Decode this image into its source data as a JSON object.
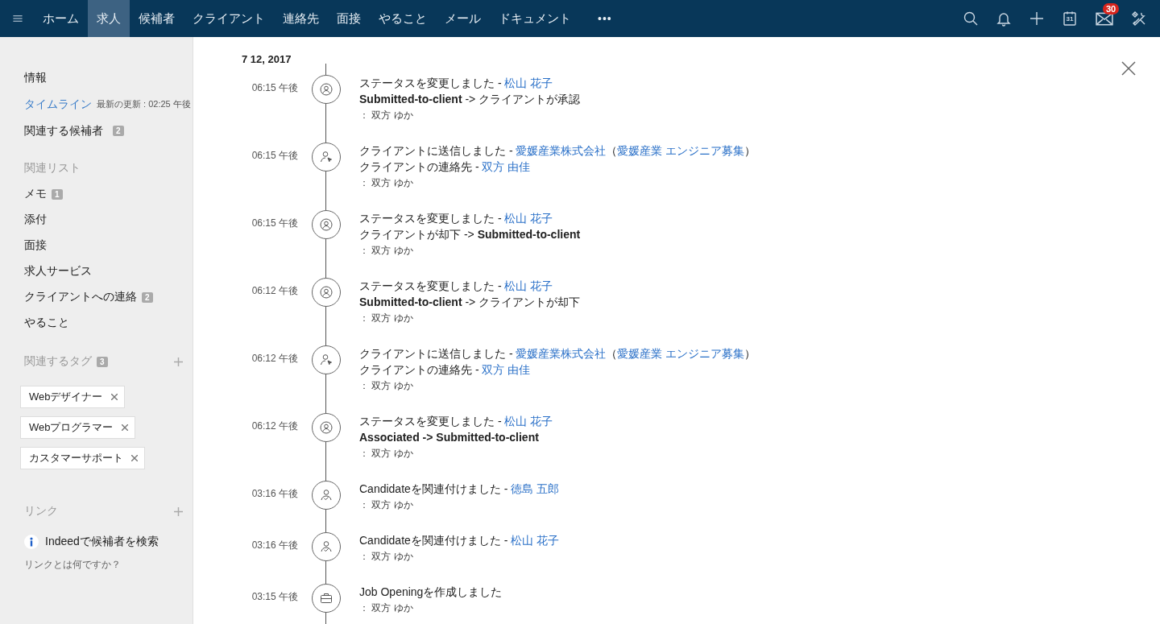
{
  "nav": {
    "tabs": [
      {
        "label": "ホーム",
        "selected": false
      },
      {
        "label": "求人",
        "selected": true
      },
      {
        "label": "候補者",
        "selected": false
      },
      {
        "label": "クライアント",
        "selected": false
      },
      {
        "label": "連絡先",
        "selected": false
      },
      {
        "label": "面接",
        "selected": false
      },
      {
        "label": "やること",
        "selected": false
      },
      {
        "label": "メール",
        "selected": false
      },
      {
        "label": "ドキュメント",
        "selected": false
      }
    ],
    "more": "•••",
    "calendar_day": "31",
    "mail_badge": "30"
  },
  "sidebar": {
    "items": [
      {
        "label": "情報",
        "selected": false
      },
      {
        "label": "タイムライン",
        "selected": true,
        "note": "最新の更新 : 02:25 午後"
      },
      {
        "label": "関連する候補者",
        "selected": false,
        "badge": "2"
      }
    ],
    "related": {
      "heading": "関連リスト",
      "items": [
        {
          "label": "メモ",
          "badge": "1"
        },
        {
          "label": "添付"
        },
        {
          "label": "面接"
        },
        {
          "label": "求人サービス"
        },
        {
          "label": "クライアントへの連絡",
          "badge": "2"
        },
        {
          "label": "やること"
        }
      ]
    },
    "tags": {
      "heading": "関連するタグ",
      "badge": "3",
      "items": [
        "Webデザイナー",
        "Webプログラマー",
        "カスタマーサポート"
      ]
    },
    "links": {
      "heading": "リンク",
      "items": [
        "Indeedで候補者を検索"
      ],
      "help": "リンクとは何ですか？"
    }
  },
  "timeline": {
    "date": "7 12, 2017",
    "entries": [
      {
        "time": "06:15 午後",
        "kind": "status",
        "lines": [
          [
            {
              "kind": "text",
              "text": "ステータスを変更しました - "
            },
            {
              "kind": "link",
              "text": "松山 花子"
            }
          ],
          [
            {
              "kind": "text",
              "text": "**Submitted-to-client** -> クライアントが承認"
            }
          ]
        ],
        "author": "： 双方 ゆか"
      },
      {
        "time": "06:15 午後",
        "kind": "sent",
        "lines": [
          [
            {
              "kind": "text",
              "text": "クライアントに送信しました - "
            },
            {
              "kind": "link",
              "text": "愛媛産業株式会社"
            },
            {
              "kind": "text",
              "text": "（"
            },
            {
              "kind": "link",
              "text": "愛媛産業 エンジニア募集"
            },
            {
              "kind": "text",
              "text": "）"
            }
          ],
          [
            {
              "kind": "text",
              "text": "クライアントの連絡先 - "
            },
            {
              "kind": "link",
              "text": "双方 由佳"
            }
          ]
        ],
        "author": "： 双方 ゆか"
      },
      {
        "time": "06:15 午後",
        "kind": "status",
        "lines": [
          [
            {
              "kind": "text",
              "text": "ステータスを変更しました - "
            },
            {
              "kind": "link",
              "text": "松山 花子"
            }
          ],
          [
            {
              "kind": "text",
              "text": "クライアントが却下 -> **Submitted-to-client**"
            }
          ]
        ],
        "author": "： 双方 ゆか"
      },
      {
        "time": "06:12 午後",
        "kind": "status",
        "lines": [
          [
            {
              "kind": "text",
              "text": "ステータスを変更しました - "
            },
            {
              "kind": "link",
              "text": "松山 花子"
            }
          ],
          [
            {
              "kind": "text",
              "text": "**Submitted-to-client** -> クライアントが却下"
            }
          ]
        ],
        "author": "： 双方 ゆか"
      },
      {
        "time": "06:12 午後",
        "kind": "sent",
        "lines": [
          [
            {
              "kind": "text",
              "text": "クライアントに送信しました - "
            },
            {
              "kind": "link",
              "text": "愛媛産業株式会社"
            },
            {
              "kind": "text",
              "text": "（"
            },
            {
              "kind": "link",
              "text": "愛媛産業 エンジニア募集"
            },
            {
              "kind": "text",
              "text": "）"
            }
          ],
          [
            {
              "kind": "text",
              "text": "クライアントの連絡先 - "
            },
            {
              "kind": "link",
              "text": "双方 由佳"
            }
          ]
        ],
        "author": "： 双方 ゆか"
      },
      {
        "time": "06:12 午後",
        "kind": "status",
        "lines": [
          [
            {
              "kind": "text",
              "text": "ステータスを変更しました - "
            },
            {
              "kind": "link",
              "text": "松山 花子"
            }
          ],
          [
            {
              "kind": "text",
              "text": "**Associated -> Submitted-to-client**"
            }
          ]
        ],
        "author": "： 双方 ゆか"
      },
      {
        "time": "03:16 午後",
        "kind": "associated",
        "lines": [
          [
            {
              "kind": "text",
              "text": "Candidateを関連付けました - "
            },
            {
              "kind": "link",
              "text": "徳島 五郎"
            }
          ]
        ],
        "author": "： 双方 ゆか"
      },
      {
        "time": "03:16 午後",
        "kind": "associated",
        "lines": [
          [
            {
              "kind": "text",
              "text": "Candidateを関連付けました - "
            },
            {
              "kind": "link",
              "text": "松山 花子"
            }
          ]
        ],
        "author": "： 双方 ゆか"
      },
      {
        "time": "03:15 午後",
        "kind": "created",
        "lines": [
          [
            {
              "kind": "text",
              "text": "Job Openingを作成しました"
            }
          ]
        ],
        "author": "： 双方 ゆか"
      }
    ]
  }
}
